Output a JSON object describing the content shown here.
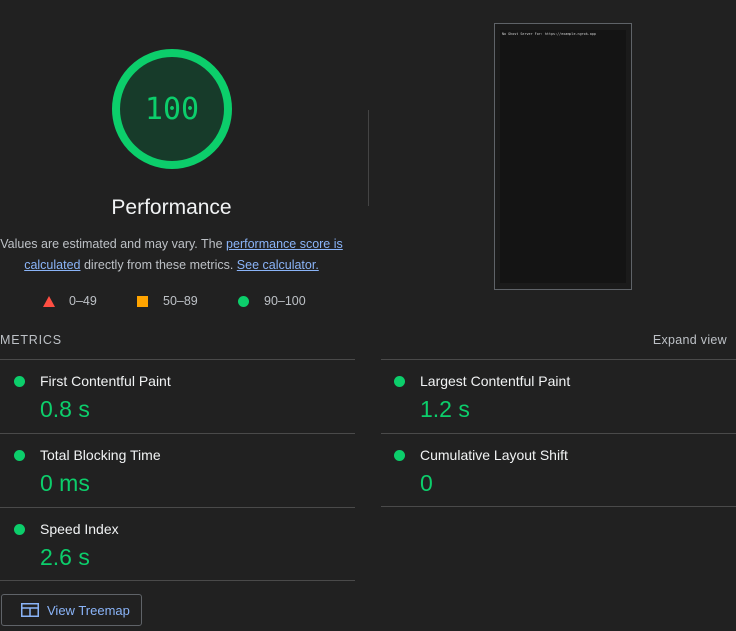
{
  "gauge": {
    "score": "100",
    "score_fraction": 1.0,
    "title": "Performance",
    "color": "#0cce6b"
  },
  "description": {
    "text_before": "Values are estimated and may vary. The ",
    "link1": "performance score is calculated",
    "text_middle": " directly from these metrics. ",
    "link2": "See calculator."
  },
  "legend": [
    {
      "icon": "triangle-icon",
      "label": "0–49",
      "color": "#ff4e42"
    },
    {
      "icon": "square-icon",
      "label": "50–89",
      "color": "#ffa400"
    },
    {
      "icon": "circle-icon",
      "label": "90–100",
      "color": "#0cce6b"
    }
  ],
  "screenshot": {
    "text": "No Ghost Server For: https://example.ngrok.app"
  },
  "metrics_header": "METRICS",
  "expand_view": "Expand view",
  "metrics": [
    {
      "title": "First Contentful Paint",
      "value": "0.8 s"
    },
    {
      "title": "Largest Contentful Paint",
      "value": "1.2 s"
    },
    {
      "title": "Total Blocking Time",
      "value": "0 ms"
    },
    {
      "title": "Cumulative Layout Shift",
      "value": "0"
    },
    {
      "title": "Speed Index",
      "value": "2.6 s"
    }
  ],
  "treemap_button": {
    "label": "View Treemap",
    "icon": "treemap-icon"
  }
}
